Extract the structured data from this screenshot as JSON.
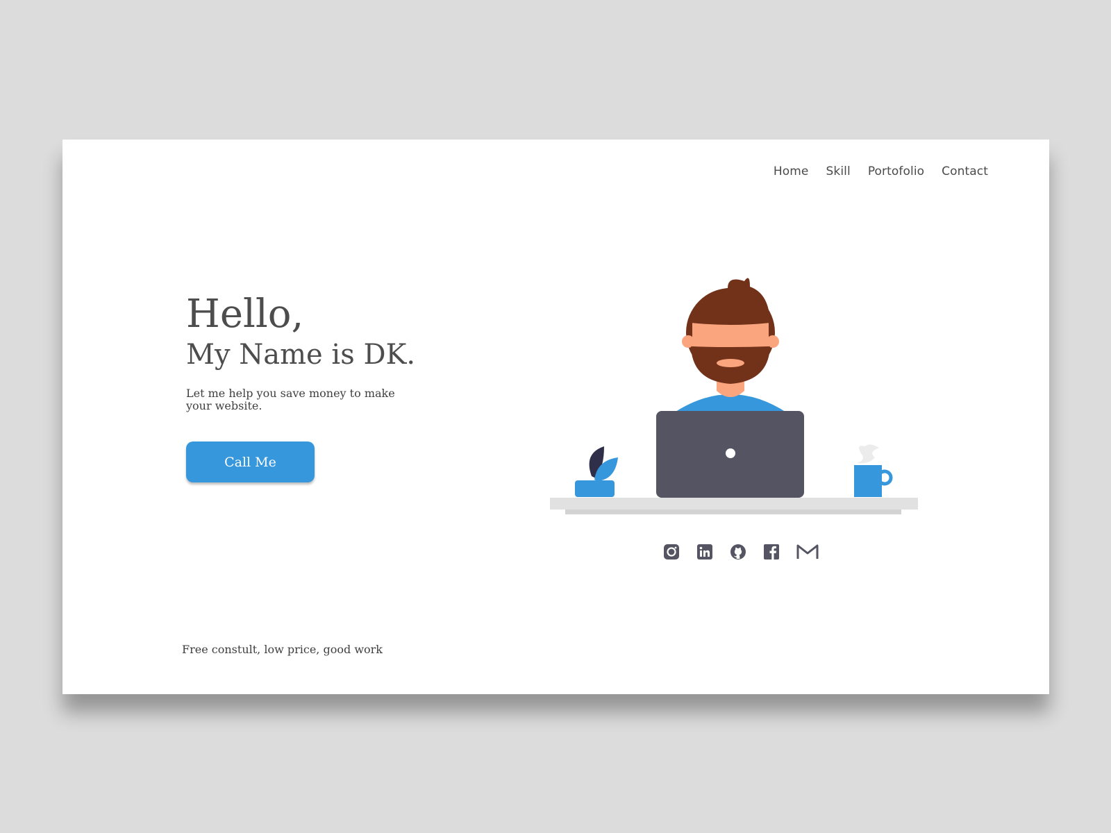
{
  "nav": {
    "items": [
      {
        "label": "Home"
      },
      {
        "label": "Skill"
      },
      {
        "label": "Portofolio"
      },
      {
        "label": "Contact"
      }
    ]
  },
  "hero": {
    "greeting": "Hello,",
    "name_line": "My Name is DK.",
    "subtitle": "Let me help you save money to make your website.",
    "cta_label": "Call Me"
  },
  "social": [
    "instagram-icon",
    "linkedin-icon",
    "github-icon",
    "facebook-icon",
    "gmail-icon"
  ],
  "footer": {
    "tagline": "Free constult, low price, good work"
  },
  "colors": {
    "accent": "#3797dc",
    "text": "#4d4d4d",
    "laptop": "#545463",
    "hair": "#72321a",
    "skin": "#fba57e",
    "background": "#dcdcdc"
  }
}
